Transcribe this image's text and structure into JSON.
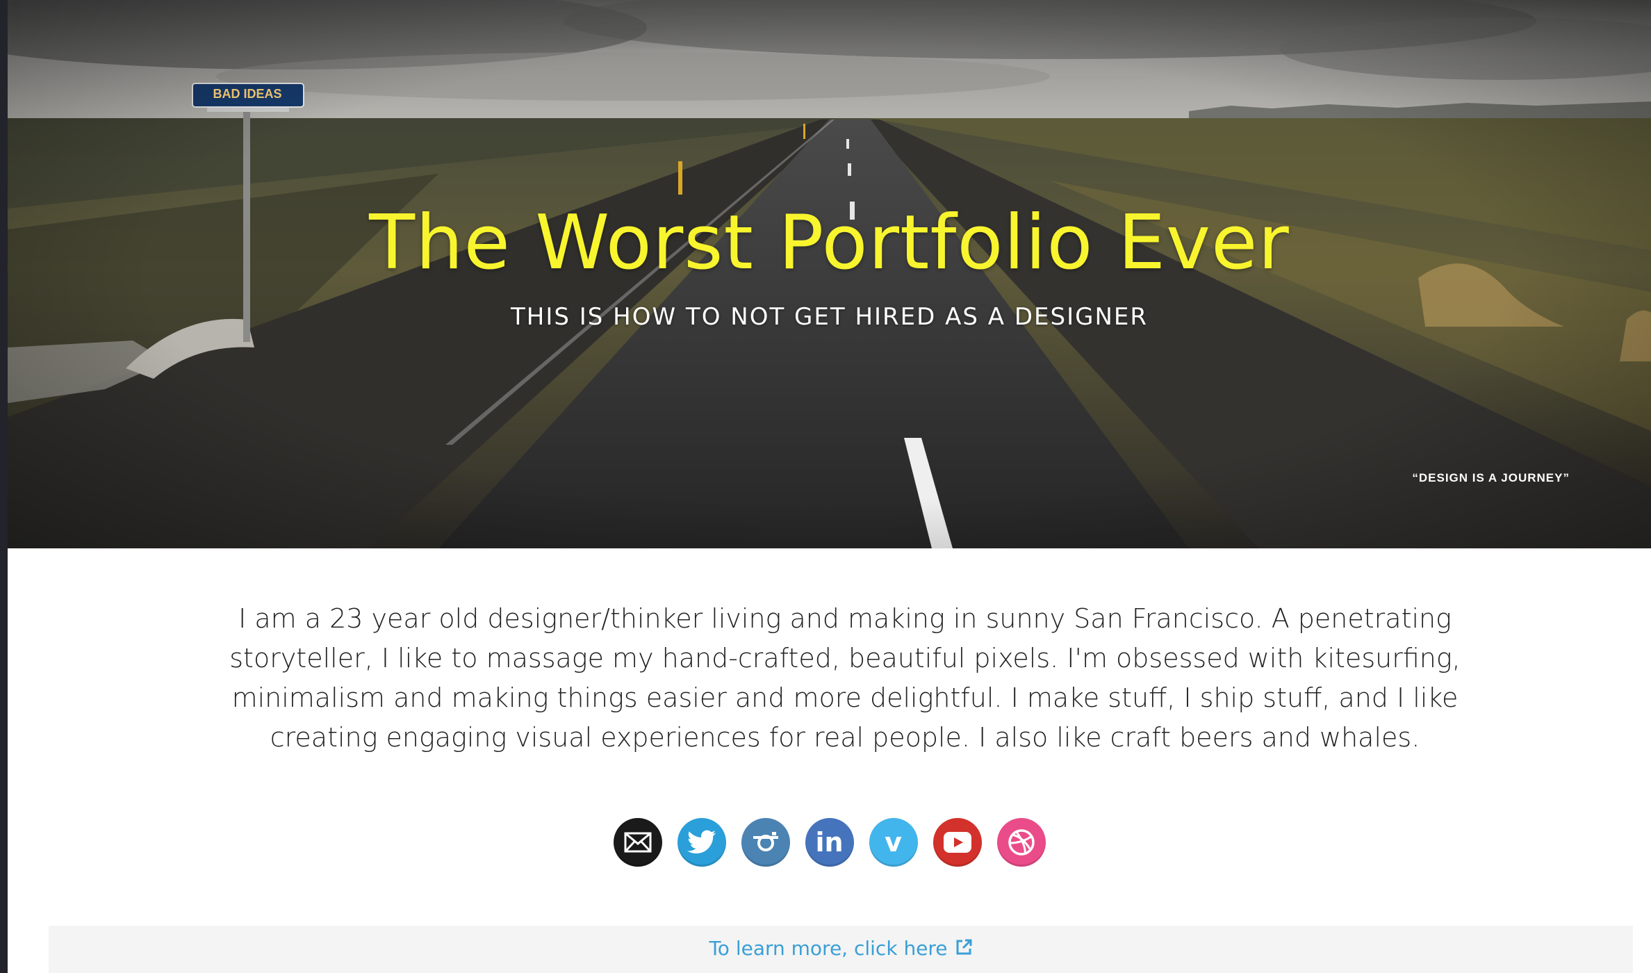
{
  "hero": {
    "title": "The Worst Portfolio Ever",
    "subtitle": "THIS IS HOW TO NOT GET HIRED AS A DESIGNER",
    "sign_text": "BAD IDEAS",
    "caption": "“DESIGN IS A JOURNEY”"
  },
  "bio": {
    "text": "I am a 23 year old designer/thinker living and making in sunny San Francisco. A penetrating storyteller, I like to massage my hand-crafted, beautiful pixels. I'm obsessed with kitesurfing, minimalism and making things easier and more delightful. I make stuff, I ship stuff, and I like creating engaging visual experiences for real people. I also like craft beers and whales."
  },
  "social": [
    {
      "icon": "mail-icon",
      "color": "#1a1a1a"
    },
    {
      "icon": "twitter-icon",
      "color": "#2b9fd9"
    },
    {
      "icon": "instagram-icon",
      "color": "#4b83b3"
    },
    {
      "icon": "linkedin-icon",
      "color": "#4574bd"
    },
    {
      "icon": "vimeo-icon",
      "color": "#42b5ec"
    },
    {
      "icon": "youtube-icon",
      "color": "#d3312b"
    },
    {
      "icon": "dribbble-icon",
      "color": "#ea4c89"
    }
  ],
  "learn_more": {
    "label": "To learn more, click here",
    "icon": "external-link-icon",
    "color": "#3a9fd6"
  },
  "colors": {
    "title": "#f8f52e",
    "text": "#222222",
    "bar_background": "#f4f4f4"
  }
}
